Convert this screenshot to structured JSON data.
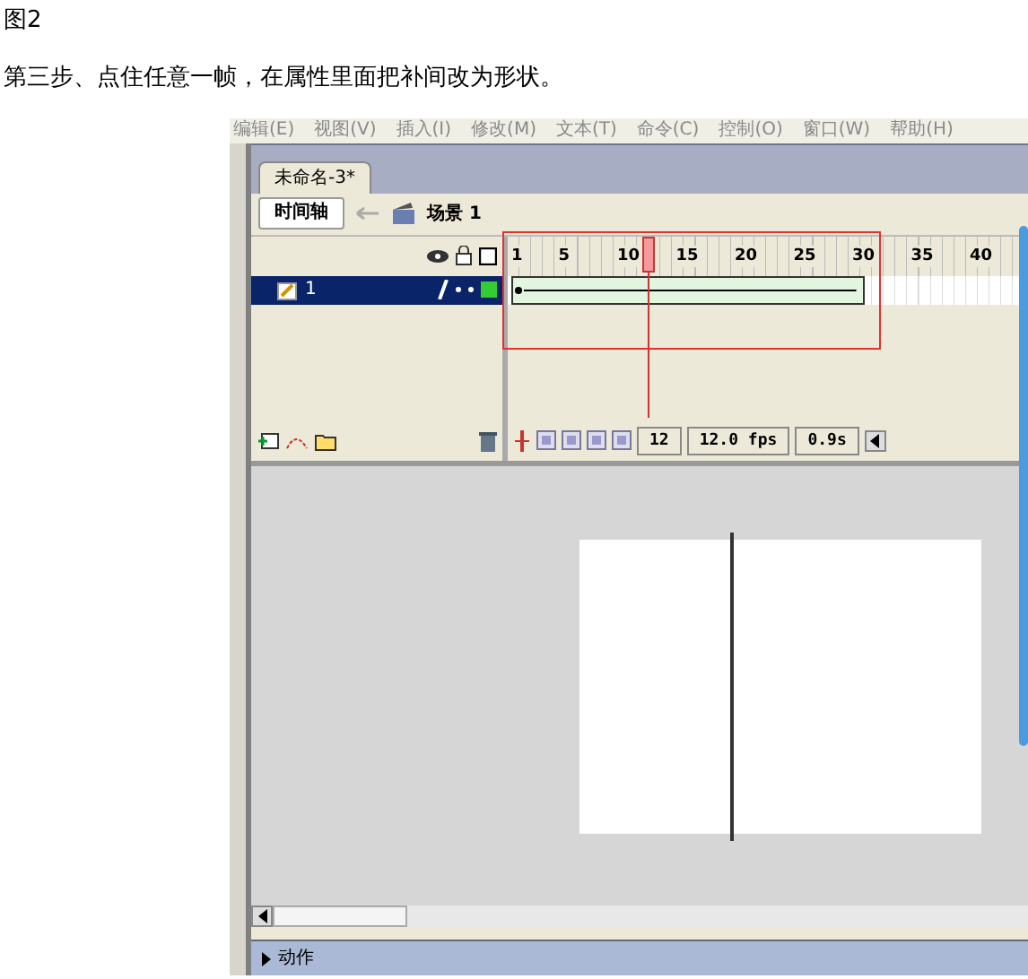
{
  "caption": "图2",
  "instruction": "第三步、点住任意一帧，在属性里面把补间改为形状。",
  "app": {
    "menu": [
      "编辑(E)",
      "视图(V)",
      "插入(I)",
      "修改(M)",
      "文本(T)",
      "命令(C)",
      "控制(O)",
      "窗口(W)",
      "帮助(H)"
    ],
    "document_tab": {
      "label": "未命名-3*",
      "selected": true
    },
    "timeline_button": "时间轴",
    "scene": "场景 1",
    "ruler": [
      "1",
      "5",
      "10",
      "15",
      "20",
      "25",
      "30",
      "35",
      "40"
    ],
    "playhead": {
      "level": 0.26
    },
    "layers": [
      {
        "name": "1",
        "selected": true,
        "tween": {
          "kind": "shape",
          "level": 0.68
        }
      }
    ],
    "status": {
      "frame": "12",
      "rate": "12.0 fps",
      "time": "0.9s"
    },
    "panel": {
      "label": "动作",
      "expanded": false
    }
  }
}
